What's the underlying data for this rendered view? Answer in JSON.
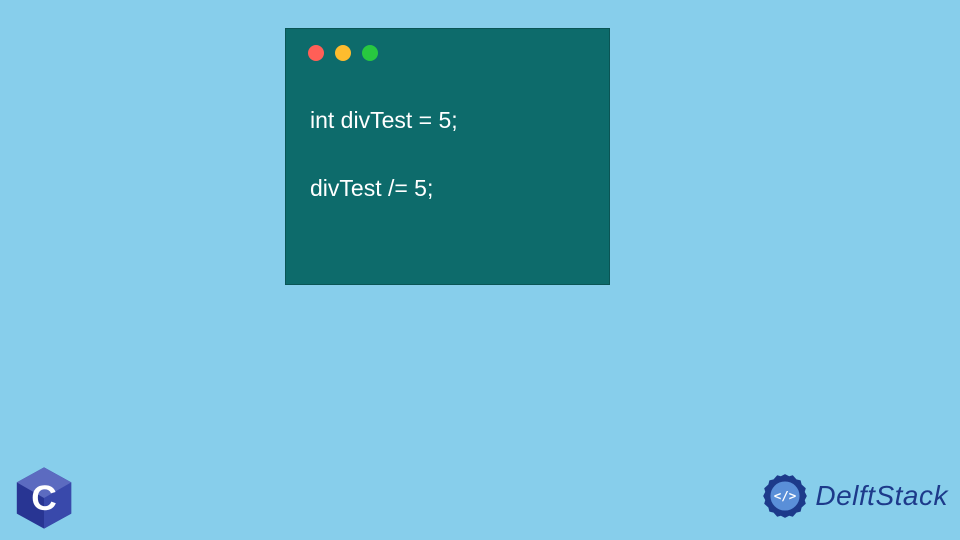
{
  "code": {
    "line1": "int divTest = 5;",
    "line2": "divTest /= 5;"
  },
  "brand": {
    "name": "DelftStack"
  },
  "colors": {
    "background": "#87ceeb",
    "codeWindow": "#0d6b6b",
    "codeText": "#ffffff",
    "trafficRed": "#ff5f57",
    "trafficYellow": "#febc2e",
    "trafficGreen": "#28c840",
    "brandBlue": "#1d3a8a"
  }
}
